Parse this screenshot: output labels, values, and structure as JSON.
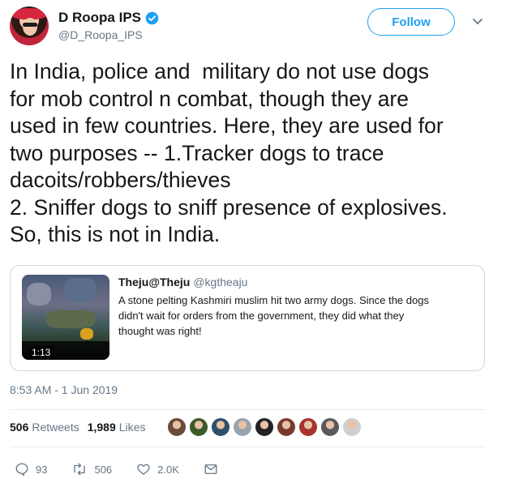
{
  "author": {
    "name": "D Roopa IPS",
    "handle": "@D_Roopa_IPS",
    "follow_label": "Follow"
  },
  "tweet": {
    "lines": [
      "In India, police and  military do not use dogs",
      "for mob control n combat, though they are",
      "used in few countries. Here, they are used for",
      "two purposes -- 1.Tracker dogs to trace",
      "dacoits/robbers/thieves",
      "2. Sniffer dogs to sniff presence of explosives.",
      "So, this is not in India."
    ]
  },
  "quoted": {
    "name": "Theju@Theju",
    "handle": "@kgtheaju",
    "duration": "1:13",
    "lines": [
      "A stone pelting Kashmiri muslim hit two army dogs. Since the dogs",
      "didn't wait for orders from the government, they did what they",
      "thought was right!"
    ]
  },
  "timestamp": "8:53 AM - 1 Jun 2019",
  "stats": {
    "retweets_count": "506",
    "retweets_label": "Retweets",
    "likes_count": "1,989",
    "likes_label": "Likes"
  },
  "liker_avatars": [
    "#6b4a3a",
    "#3d5a2a",
    "#2f4f6e",
    "#9aa3ad",
    "#222222",
    "#7a3b2e",
    "#a8332f",
    "#5a5a5a",
    "#cfcfcf"
  ],
  "actions": {
    "replies": "93",
    "retweets": "506",
    "likes": "2.0K"
  },
  "colors": {
    "accent": "#1da1f2",
    "secondary_text": "#657786",
    "border": "#ccd6dd"
  }
}
